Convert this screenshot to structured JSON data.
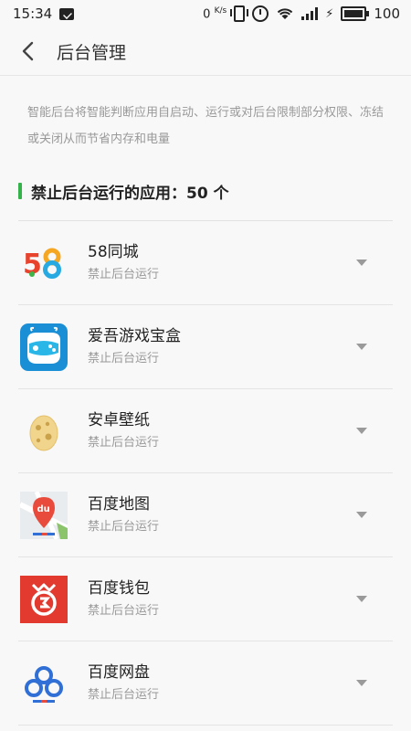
{
  "status_bar": {
    "time": "15:34",
    "speed": "0",
    "speed_unit": "K/s",
    "battery": "100"
  },
  "header": {
    "title": "后台管理"
  },
  "description": "智能后台将智能判断应用自启动、运行或对后台限制部分权限、冻结或关闭从而节省内存和电量",
  "section": {
    "title": "禁止后台运行的应用：50 个",
    "accent": "#33b34a"
  },
  "apps": [
    {
      "name": "58同城",
      "status": "禁止后台运行",
      "icon": "58-logo-icon"
    },
    {
      "name": "爱吾游戏宝盒",
      "status": "禁止后台运行",
      "icon": "game-controller-icon"
    },
    {
      "name": "安卓壁纸",
      "status": "禁止后台运行",
      "icon": "egg-icon"
    },
    {
      "name": "百度地图",
      "status": "禁止后台运行",
      "icon": "map-pin-icon"
    },
    {
      "name": "百度钱包",
      "status": "禁止后台运行",
      "icon": "wallet-icon"
    },
    {
      "name": "百度网盘",
      "status": "禁止后台运行",
      "icon": "cloud-icon"
    }
  ]
}
